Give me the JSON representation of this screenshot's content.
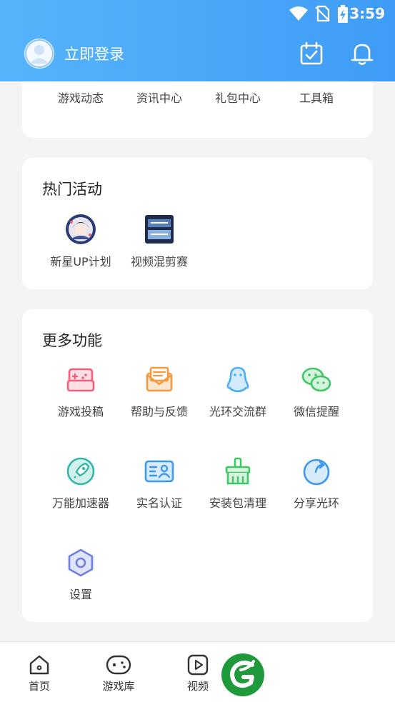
{
  "status_bar": {
    "time": "3:59"
  },
  "header": {
    "login_text": "立即登录"
  },
  "top_grid": [
    {
      "label": "游戏动态",
      "icon": "game-news-icon"
    },
    {
      "label": "资讯中心",
      "icon": "info-center-icon"
    },
    {
      "label": "礼包中心",
      "icon": "gift-center-icon"
    },
    {
      "label": "工具箱",
      "icon": "toolbox-icon"
    }
  ],
  "hot_activities": {
    "title": "热门活动",
    "items": [
      {
        "label": "新星UP计划",
        "icon": "new-star-up-plan-icon"
      },
      {
        "label": "视频混剪赛",
        "icon": "video-remix-contest-icon"
      }
    ]
  },
  "more_features": {
    "title": "更多功能",
    "items": [
      {
        "label": "游戏投稿",
        "icon": "game-submission-icon",
        "color": "#f0607a"
      },
      {
        "label": "帮助与反馈",
        "icon": "help-feedback-icon",
        "color": "#f79a3e"
      },
      {
        "label": "光环交流群",
        "icon": "qq-penguin-icon",
        "color": "#4aaef5"
      },
      {
        "label": "微信提醒",
        "icon": "wechat-icon",
        "color": "#3cc862"
      },
      {
        "label": "万能加速器",
        "icon": "rocket-icon",
        "color": "#2fb8a8"
      },
      {
        "label": "实名认证",
        "icon": "id-card-icon",
        "color": "#3d97ef"
      },
      {
        "label": "安装包清理",
        "icon": "broom-icon",
        "color": "#3cc862"
      },
      {
        "label": "分享光环",
        "icon": "share-icon",
        "color": "#3d97ef"
      },
      {
        "label": "设置",
        "icon": "settings-hex-icon",
        "color": "#6f7fe0"
      }
    ]
  },
  "bottom_nav": [
    {
      "label": "首页",
      "icon": "home-icon"
    },
    {
      "label": "游戏库",
      "icon": "game-library-icon"
    },
    {
      "label": "视频",
      "icon": "video-icon"
    }
  ],
  "colors": {
    "header_start": "#55b4fb",
    "header_end": "#3f9cf6",
    "brand_green": "#1f9a3a"
  }
}
